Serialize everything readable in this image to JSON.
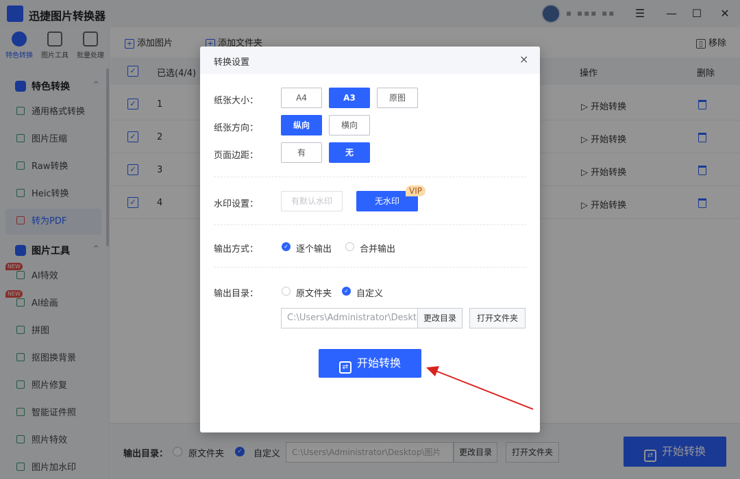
{
  "app": {
    "title": "迅捷图片转换器",
    "user_name": "▪ ▪▪▪ ▪▪"
  },
  "window_controls": {
    "menu": "☰",
    "minimize": "—",
    "maximize": "☐",
    "close": "✕"
  },
  "sidebar": {
    "top_tabs": [
      {
        "label": "特色转换",
        "active": true
      },
      {
        "label": "图片工具",
        "active": false
      },
      {
        "label": "批量处理",
        "active": false
      }
    ],
    "sections": [
      {
        "label": "特色转换",
        "items": [
          "通用格式转换",
          "图片压缩",
          "Raw转换",
          "Heic转换",
          "转为PDF"
        ]
      },
      {
        "label": "图片工具",
        "items": [
          "AI特效",
          "AI绘画",
          "拼图",
          "抠图换背景",
          "照片修复",
          "智能证件照",
          "照片特效",
          "图片加水印"
        ]
      }
    ],
    "new_badge": "NEW",
    "caret": "^"
  },
  "toolbar": {
    "add_image": "添加图片",
    "add_folder": "添加文件夹",
    "remove": "移除"
  },
  "table": {
    "headers": {
      "selected": "已选(4/4)",
      "action": "操作",
      "delete": "删除"
    },
    "rows": [
      {
        "index": "1",
        "action": "开始转换"
      },
      {
        "index": "2",
        "action": "开始转换"
      },
      {
        "index": "3",
        "action": "开始转换"
      },
      {
        "index": "4",
        "action": "开始转换"
      }
    ]
  },
  "bottom": {
    "label": "输出目录：",
    "opt_original": "原文件夹",
    "opt_custom": "自定义",
    "path": "C:\\Users\\Administrator\\Desktop\\图片",
    "change_dir": "更改目录",
    "open_folder": "打开文件夹",
    "start": "开始转换"
  },
  "dialog": {
    "title": "转换设置",
    "close": "×",
    "paper_size": {
      "label": "纸张大小：",
      "options": [
        "A4",
        "A3",
        "原图"
      ],
      "selected": "A3"
    },
    "orientation": {
      "label": "纸张方向：",
      "options": [
        "纵向",
        "横向"
      ],
      "selected": "纵向"
    },
    "margin": {
      "label": "页面边距：",
      "options": [
        "有",
        "无"
      ],
      "selected": "无"
    },
    "watermark": {
      "label": "水印设置：",
      "default_option": "有默认水印",
      "no_watermark": "无水印",
      "vip": "VIP"
    },
    "output_mode": {
      "label": "输出方式：",
      "one_by_one": "逐个输出",
      "merge": "合并输出",
      "selected": "逐个输出"
    },
    "output_dir": {
      "label": "输出目录：",
      "original": "原文件夹",
      "custom": "自定义",
      "selected": "自定义",
      "path": "C:\\Users\\Administrator\\Desktop\\",
      "change_dir": "更改目录",
      "open_folder": "打开文件夹"
    },
    "start": "开始转换"
  },
  "colors": {
    "accent": "#2c63ff",
    "annotation_arrow": "#d9231e",
    "new_badge": "#e6514a"
  }
}
